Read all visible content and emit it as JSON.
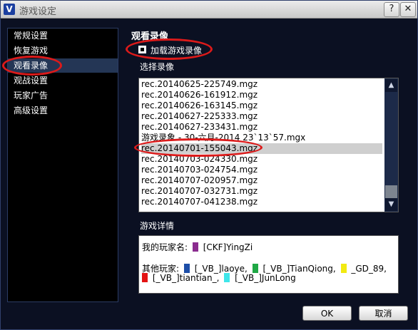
{
  "window": {
    "title": "游戏设定",
    "help_label": "?",
    "close_label": "✕"
  },
  "sidebar": {
    "items": [
      {
        "label": "常规设置"
      },
      {
        "label": "恢复游戏"
      },
      {
        "label": "观看录像"
      },
      {
        "label": "观战设置"
      },
      {
        "label": "玩家广告"
      },
      {
        "label": "高级设置"
      }
    ],
    "active_index": 2
  },
  "panel": {
    "title": "观看录像",
    "load_checkbox": {
      "label": "加载游戏录像",
      "checked": true
    },
    "replay_list_label": "选择录像",
    "replays": [
      "rec.20140625-225749.mgz",
      "rec.20140626-161912.mgz",
      "rec.20140626-163145.mgz",
      "rec.20140627-225333.mgz",
      "rec.20140627-233431.mgz",
      "游戏录象 - 30-六月-2014 23`13`57.mgx",
      "rec.20140701-155043.mgz",
      "rec.20140703-024330.mgz",
      "rec.20140703-024754.mgz",
      "rec.20140707-020957.mgz",
      "rec.20140707-032731.mgz",
      "rec.20140707-041238.mgz"
    ],
    "selected_index": 6,
    "details_label": "游戏详情",
    "details": {
      "my_player_label": "我的玩家名:",
      "my_player": {
        "name": "[CKF]YingZi",
        "color": "#8b2c8f"
      },
      "other_players_label": "其他玩家:",
      "others": [
        {
          "name": "[_VB_]laoye,",
          "color": "#1d4ea8"
        },
        {
          "name": "[_VB_]TianQiong,",
          "color": "#1fa845"
        },
        {
          "name": "_GD_89,",
          "color": "#f2ea12"
        },
        {
          "name": "[_VB_]tiantian_,",
          "color": "#e31414"
        },
        {
          "name": "[_VB_]JunLong",
          "color": "#3fe6ea"
        }
      ]
    }
  },
  "buttons": {
    "ok": "OK",
    "cancel": "取消"
  },
  "colors": {
    "highlight_ring": "#dc1a1a",
    "window_bg": "#0b1022",
    "selected_nav": "#243655"
  }
}
